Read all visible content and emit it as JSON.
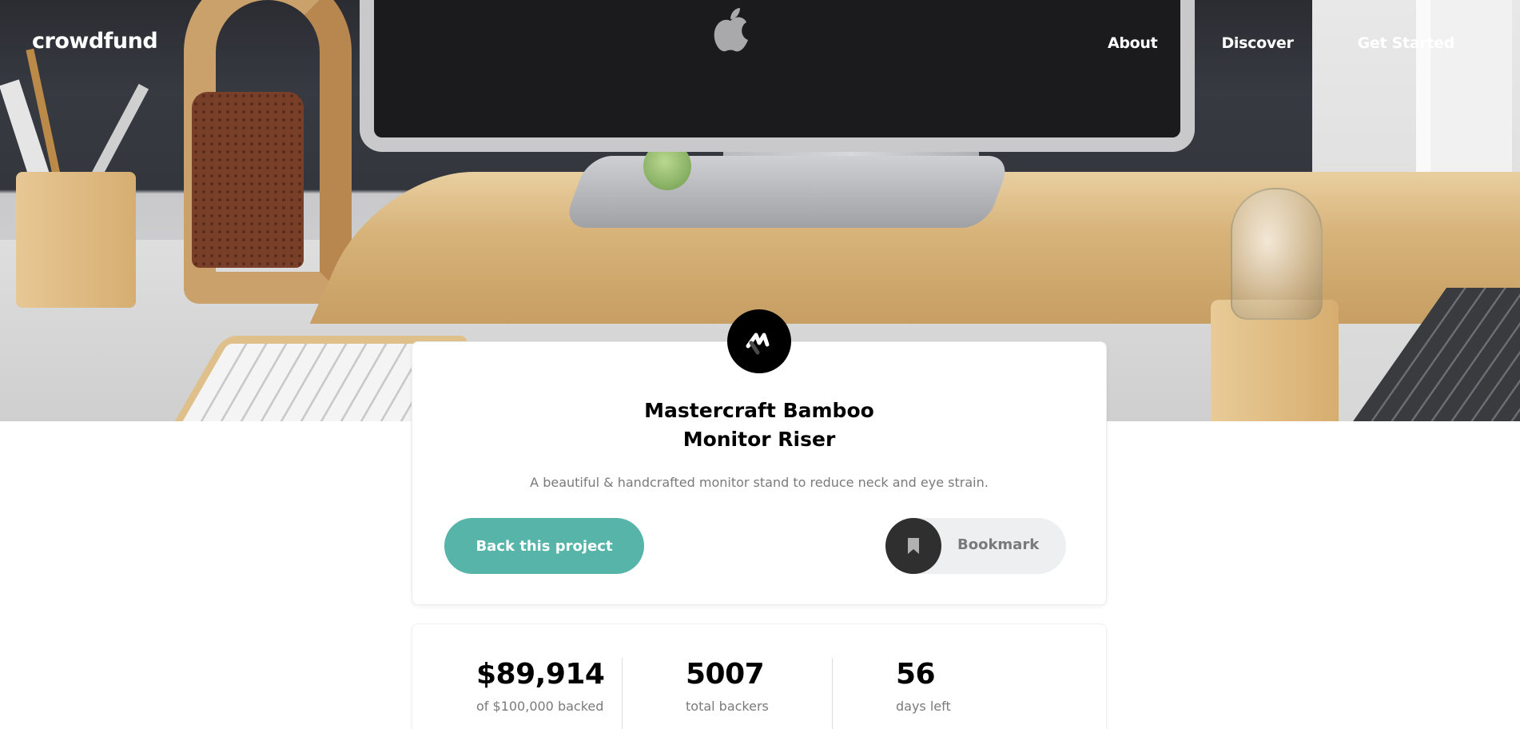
{
  "nav": {
    "logo": "crowdfund",
    "links": [
      "About",
      "Discover",
      "Get Started"
    ]
  },
  "project": {
    "logo_icon": "mastercraft-logo-icon",
    "title_line1": "Mastercraft Bamboo",
    "title_line2": "Monitor Riser",
    "description": "A beautiful & handcrafted monitor stand to reduce neck and eye strain.",
    "back_label": "Back this project",
    "bookmark_label": "Bookmark",
    "bookmark_icon": "bookmark-icon"
  },
  "stats": [
    {
      "value": "$89,914",
      "label": "of $100,000 backed"
    },
    {
      "value": "5007",
      "label": "total backers"
    },
    {
      "value": "56",
      "label": "days left"
    }
  ],
  "colors": {
    "accent": "#56b4a9",
    "dark": "#000000",
    "muted_text": "#7a7a7a",
    "bookmark_bg": "#eeeff1",
    "bookmark_circle": "#2f2f2f"
  }
}
